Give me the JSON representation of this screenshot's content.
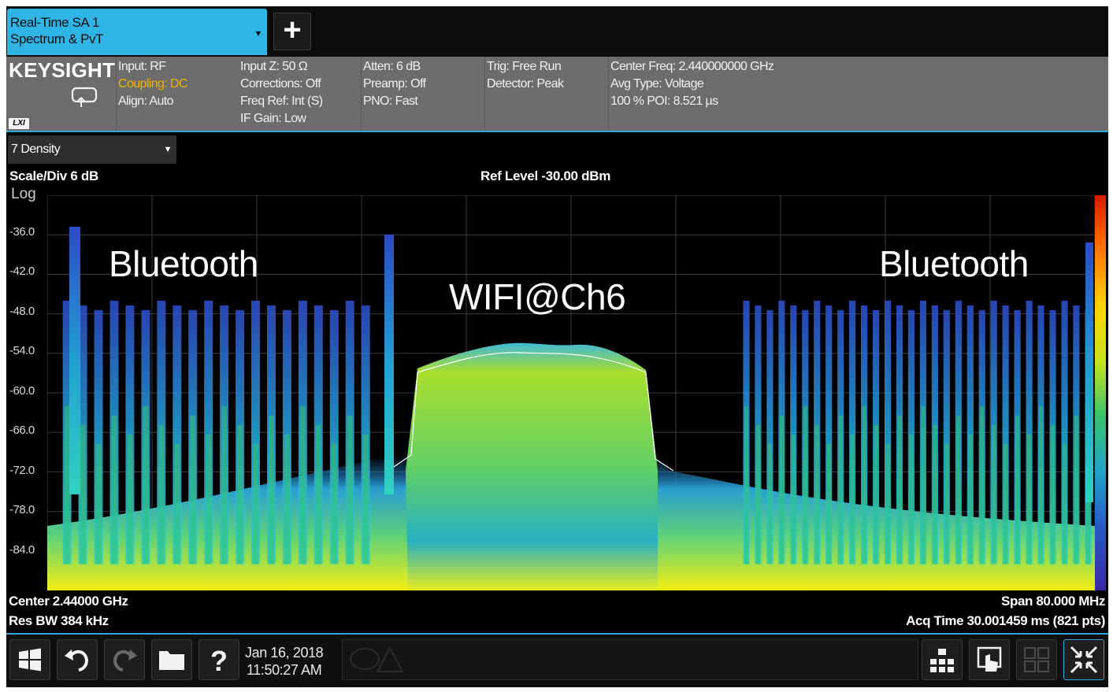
{
  "tab": {
    "title_line1": "Real-Time SA 1",
    "title_line2": "Spectrum & PvT"
  },
  "settings": {
    "brand": "KEYSIGHT",
    "badge": "LXI",
    "col1": [
      "Input: RF",
      "Coupling: DC",
      "Align: Auto"
    ],
    "col2": [
      "Input Z: 50 Ω",
      "Corrections: Off",
      "Freq Ref: Int (S)",
      "IF Gain: Low"
    ],
    "col3": [
      "Atten: 6 dB",
      "Preamp: Off",
      "PNO: Fast"
    ],
    "col4": [
      "Trig: Free Run",
      "Detector: Peak"
    ],
    "col5": [
      "Center Freq: 2.440000000 GHz",
      "Avg Type: Voltage",
      "100 % POI: 8.521 µs"
    ]
  },
  "window": {
    "view_selector": "7 Density",
    "scale_div": "Scale/Div 6 dB",
    "ref_level": "Ref Level -30.00 dBm",
    "log_label": "Log",
    "annotations": {
      "left": "Bluetooth",
      "center": "WIFI@Ch6",
      "right": "Bluetooth"
    },
    "center": "Center 2.44000 GHz",
    "res_bw": "Res BW 384 kHz",
    "span": "Span 80.000 MHz",
    "acq_time": "Acq Time 30.001459 ms (821 pts)"
  },
  "chart_data": {
    "type": "heatmap",
    "y_ticks": [
      "-36.0",
      "-42.0",
      "-48.0",
      "-54.0",
      "-60.0",
      "-66.0",
      "-72.0",
      "-78.0",
      "-84.0"
    ],
    "ylim": [
      -90,
      -30
    ],
    "xlim_mhz": [
      2400,
      2480
    ],
    "regions": [
      {
        "name": "Bluetooth",
        "from_mhz": 2401,
        "to_mhz": 2425,
        "peak_dbm": -46
      },
      {
        "name": "WIFI@Ch6",
        "from_mhz": 2428,
        "to_mhz": 2446,
        "peak_dbm": -55
      },
      {
        "name": "Bluetooth",
        "from_mhz": 2453,
        "to_mhz": 2480,
        "peak_dbm": -46
      }
    ],
    "colors": {
      "hot": "#ffd400",
      "mid": "#36c36c",
      "cool": "#1fa3c8",
      "sparse": "#2759c9"
    }
  },
  "taskbar": {
    "date": "Jan 16, 2018",
    "time": "11:50:27 AM"
  },
  "icons": [
    "windows-icon",
    "undo-icon",
    "redo-icon",
    "folder-icon",
    "help-icon",
    "layout-icon",
    "touch-icon",
    "grid-icon",
    "fullscreen-icon"
  ]
}
